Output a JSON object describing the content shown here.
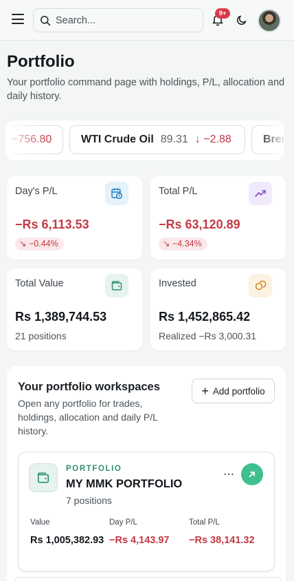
{
  "header": {
    "search_placeholder": "Search...",
    "notification_badge": "9+"
  },
  "page": {
    "title": "Portfolio",
    "subtitle": "Your portfolio command page with holdings, P/L, allocation and daily history."
  },
  "ticker": {
    "items": [
      {
        "name": "",
        "price": "",
        "change": "−756.80"
      },
      {
        "name": "WTI Crude Oil",
        "price": "89.31",
        "change": "−2.88",
        "direction": "down"
      },
      {
        "name": "Bren",
        "price": "",
        "change": ""
      }
    ]
  },
  "stats": {
    "day_pl": {
      "label": "Day's P/L",
      "value": "−Rs 6,113.53",
      "change": "−0.44%",
      "icon": "calendar-clock-icon",
      "icon_color": "#1f7fbf",
      "icon_bg": "#e5f1fb"
    },
    "total_pl": {
      "label": "Total P/L",
      "value": "−Rs 63,120.89",
      "change": "−4.34%",
      "icon": "trending-up-icon",
      "icon_color": "#7e4cc9",
      "icon_bg": "#f1eafc"
    },
    "total_value": {
      "label": "Total Value",
      "value": "Rs 1,389,744.53",
      "sub": "21 positions",
      "icon": "wallet-icon",
      "icon_color": "#2f8f69",
      "icon_bg": "#e6f3ee"
    },
    "invested": {
      "label": "Invested",
      "value": "Rs 1,452,865.42",
      "sub": "Realized −Rs 3,000.31",
      "icon": "coins-icon",
      "icon_color": "#d0861f",
      "icon_bg": "#fdf1e2"
    }
  },
  "workspaces": {
    "title": "Your portfolio workspaces",
    "subtitle": "Open any portfolio for trades, holdings, allocation and daily P/L history.",
    "add_button": "Add portfolio",
    "portfolios": [
      {
        "kicker": "PORTFOLIO",
        "name": "MY MMK PORTFOLIO",
        "positions": "7 positions",
        "value_label": "Value",
        "value": "Rs 1,005,382.93",
        "day_pl_label": "Day P/L",
        "day_pl": "−Rs 4,143.97",
        "total_pl_label": "Total P/L",
        "total_pl": "−Rs 38,141.32"
      }
    ]
  },
  "colors": {
    "accent": "#3fbf8d",
    "negative": "#c23a45",
    "badge": "#d93a4a",
    "background": "#f3f6f4"
  }
}
